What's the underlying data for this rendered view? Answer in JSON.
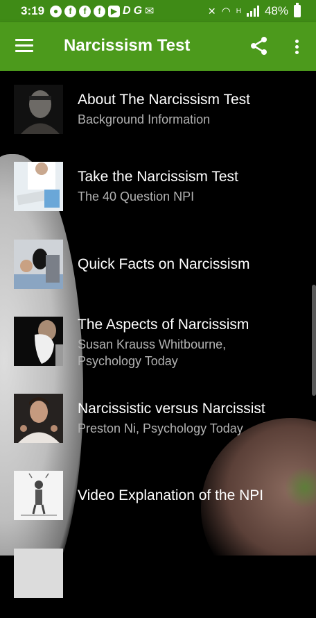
{
  "status_bar": {
    "time": "3:19",
    "battery": "48%",
    "network_letter": "H",
    "left_icons": [
      "notification-icon",
      "facebook-icon",
      "facebook-icon",
      "facebook-icon",
      "youtube-icon",
      "dictionary-d-icon",
      "g-icon",
      "mail-icon"
    ]
  },
  "app_bar": {
    "title": "Narcissism Test",
    "background": "#4c9a1c",
    "status_background": "#3f8b16"
  },
  "list": [
    {
      "title": "About The Narcissism Test",
      "subtitle": [
        "Background Information"
      ]
    },
    {
      "title": "Take the Narcissism Test",
      "subtitle": [
        "The 40 Question NPI"
      ]
    },
    {
      "title": "Quick Facts on Narcissism",
      "subtitle": []
    },
    {
      "title": "The Aspects of Narcissism",
      "subtitle": [
        "Susan Krauss Whitbourne,",
        "Psychology Today"
      ]
    },
    {
      "title": "Narcissistic versus Narcissist",
      "subtitle": [
        "Preston Ni, Psychology Today"
      ]
    },
    {
      "title": "Video Explanation of the NPI",
      "subtitle": []
    }
  ]
}
